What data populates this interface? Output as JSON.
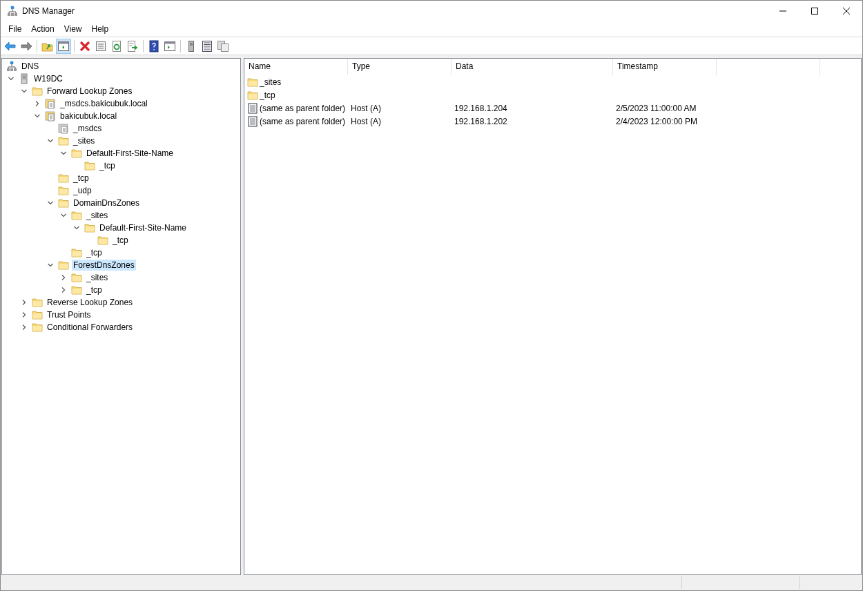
{
  "window": {
    "title": "DNS Manager"
  },
  "menu": [
    "File",
    "Action",
    "View",
    "Help"
  ],
  "toolbar": [
    {
      "kind": "back",
      "pressed": false
    },
    {
      "kind": "forward",
      "pressed": false
    },
    {
      "kind": "sep"
    },
    {
      "kind": "up",
      "pressed": false
    },
    {
      "kind": "tree",
      "pressed": true
    },
    {
      "kind": "sep"
    },
    {
      "kind": "delete",
      "pressed": false
    },
    {
      "kind": "props",
      "pressed": false
    },
    {
      "kind": "refresh",
      "pressed": false
    },
    {
      "kind": "export",
      "pressed": false
    },
    {
      "kind": "sep"
    },
    {
      "kind": "help",
      "pressed": false
    },
    {
      "kind": "pane",
      "pressed": false
    },
    {
      "kind": "sep"
    },
    {
      "kind": "server",
      "pressed": false
    },
    {
      "kind": "list",
      "pressed": false
    },
    {
      "kind": "copy",
      "pressed": false
    }
  ],
  "tree": [
    {
      "label": "DNS",
      "kind": "dns",
      "selected": false,
      "children": [
        {
          "label": "W19DC",
          "kind": "server",
          "expanded": true,
          "selected": false,
          "children": [
            {
              "label": "Forward Lookup Zones",
              "kind": "folder",
              "expanded": true,
              "selected": false,
              "children": [
                {
                  "label": "_msdcs.bakicubuk.local",
                  "kind": "zone",
                  "expanded": false,
                  "selected": false
                },
                {
                  "label": "bakicubuk.local",
                  "kind": "zone",
                  "expanded": true,
                  "selected": false,
                  "children": [
                    {
                      "label": "_msdcs",
                      "kind": "delegation",
                      "selected": false
                    },
                    {
                      "label": "_sites",
                      "kind": "folder",
                      "expanded": true,
                      "selected": false,
                      "children": [
                        {
                          "label": "Default-First-Site-Name",
                          "kind": "folder",
                          "expanded": true,
                          "selected": false,
                          "children": [
                            {
                              "label": "_tcp",
                              "kind": "folder",
                              "selected": false
                            }
                          ]
                        }
                      ]
                    },
                    {
                      "label": "_tcp",
                      "kind": "folder",
                      "selected": false
                    },
                    {
                      "label": "_udp",
                      "kind": "folder",
                      "selected": false
                    },
                    {
                      "label": "DomainDnsZones",
                      "kind": "folder",
                      "expanded": true,
                      "selected": false,
                      "children": [
                        {
                          "label": "_sites",
                          "kind": "folder",
                          "expanded": true,
                          "selected": false,
                          "children": [
                            {
                              "label": "Default-First-Site-Name",
                              "kind": "folder",
                              "expanded": true,
                              "selected": false,
                              "children": [
                                {
                                  "label": "_tcp",
                                  "kind": "folder",
                                  "selected": false
                                }
                              ]
                            }
                          ]
                        },
                        {
                          "label": "_tcp",
                          "kind": "folder",
                          "selected": false
                        }
                      ]
                    },
                    {
                      "label": "ForestDnsZones",
                      "kind": "folder",
                      "expanded": true,
                      "selected": true,
                      "children": [
                        {
                          "label": "_sites",
                          "kind": "folder",
                          "expanded": false,
                          "selected": false
                        },
                        {
                          "label": "_tcp",
                          "kind": "folder",
                          "expanded": false,
                          "selected": false
                        }
                      ]
                    }
                  ]
                }
              ]
            },
            {
              "label": "Reverse Lookup Zones",
              "kind": "folder",
              "expanded": false,
              "selected": false
            },
            {
              "label": "Trust Points",
              "kind": "folder",
              "expanded": false,
              "selected": false
            },
            {
              "label": "Conditional Forwarders",
              "kind": "folder",
              "expanded": false,
              "selected": false
            }
          ]
        }
      ]
    }
  ],
  "list": {
    "columns": [
      "Name",
      "Type",
      "Data",
      "Timestamp"
    ],
    "rows": [
      {
        "kind": "folder",
        "cells": [
          "_sites"
        ]
      },
      {
        "kind": "folder",
        "cells": [
          "_tcp"
        ]
      },
      {
        "kind": "record",
        "cells": [
          "(same as parent folder)",
          "Host (A)",
          "192.168.1.204",
          "2/5/2023 11:00:00 AM"
        ]
      },
      {
        "kind": "record",
        "cells": [
          "(same as parent folder)",
          "Host (A)",
          "192.168.1.202",
          "2/4/2023 12:00:00 PM"
        ]
      }
    ]
  }
}
